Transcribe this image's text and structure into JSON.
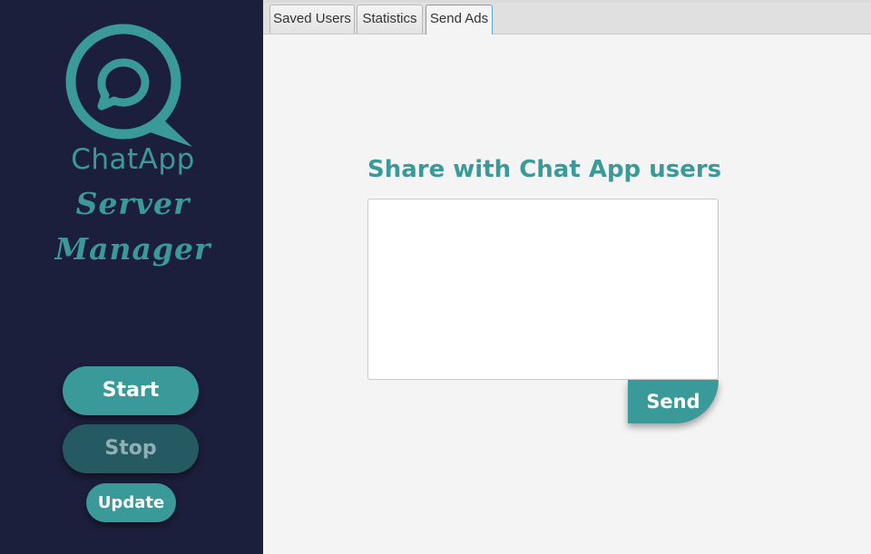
{
  "sidebar": {
    "logo_text": "ChatApp",
    "subtitle": "Server Manager",
    "buttons": {
      "start": "Start",
      "stop": "Stop",
      "update": "Update"
    }
  },
  "tabs": [
    {
      "label": "Saved Users",
      "active": false
    },
    {
      "label": "Statistics",
      "active": false
    },
    {
      "label": "Send Ads",
      "active": true
    }
  ],
  "send_ads": {
    "title": "Share with Chat App users",
    "textarea_value": "",
    "send_label": "Send"
  },
  "colors": {
    "sidebar_bg": "#1c1f3c",
    "accent": "#3a9a9a",
    "stop_disabled": "#265a62",
    "content_bg": "#f4f4f4"
  }
}
